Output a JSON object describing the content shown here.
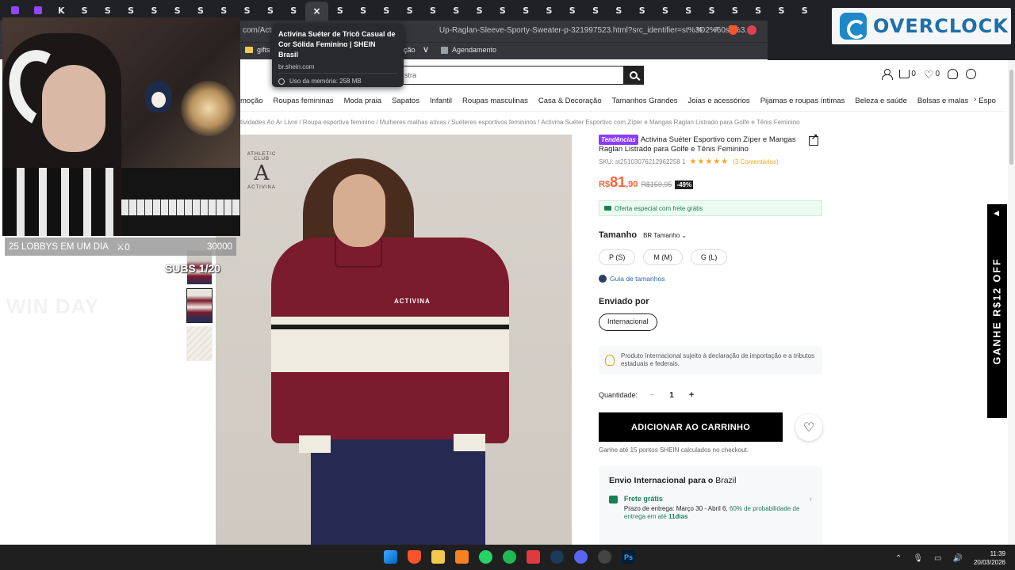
{
  "browser": {
    "tabs": [
      "twitch",
      "twitch",
      "kick",
      "S",
      "S",
      "S",
      "S",
      "S",
      "S",
      "S",
      "S",
      "S",
      "S",
      "×",
      "S",
      "S",
      "S",
      "S",
      "S",
      "S",
      "S",
      "S",
      "S",
      "S",
      "S",
      "S",
      "S",
      "S",
      "S",
      "S",
      "S",
      "S",
      "S",
      "S",
      "S"
    ],
    "active_tab_index": 13,
    "url_left": "com/Acti",
    "url_right": "Up-Raglan-Sleeve-Sporty-Sweater-p-321997523.html?src_identifier=st%3D2%60sc%3...",
    "bookmarks": [
      {
        "label": "gifts"
      },
      {
        "label": "ção"
      },
      {
        "label": "Agendamento"
      }
    ],
    "tooltip": {
      "title": "Activina Suéter de Tricô Casual de Cor Sólida Feminino | SHEIN Brasil",
      "domain": "br.shein.com",
      "memory": "Uso da memória: 258 MB"
    }
  },
  "logo": {
    "text": "OVERCLOCK"
  },
  "stream_overlay": {
    "stats_label": "25 LOBBYS EM UM DIA",
    "stats_count": "0",
    "stats_goal": "30000",
    "subs": "SUBS 1/20",
    "ghost_text": "WIN DAY"
  },
  "shein": {
    "search_placeholder": "stra",
    "header_counts": {
      "cart": "0",
      "wishlist": "0"
    },
    "categories": [
      "moção",
      "Roupas femininas",
      "Moda praia",
      "Sapatos",
      "Infantil",
      "Roupas masculinas",
      "Casa & Decoração",
      "Tamanhos Grandes",
      "Joias e acessórios",
      "Pijamas e roupas íntimas",
      "Beleza e saúde",
      "Bolsas e malas",
      "Espo"
    ],
    "breadcrumb": [
      "tividades Ao Ar Livre",
      "Roupa esportiva feminino",
      "Mulheres malhas ativas",
      "Suéteres esportivos femininos",
      "Activina Suéter Esportivo com Zíper e Mangas Raglan Listrado para Golfe e Tênis Feminino"
    ],
    "image_brand_mark": "ATHLETIC CLUB",
    "image_brand_sub": "ACTIVINA",
    "image_sweater_text": "ACTIVINA",
    "product": {
      "badge": "Tendências",
      "title": "Activina Suéter Esportivo com Zíper e Mangas Raglan Listrado para Golfe e Tênis Feminino",
      "sku": "SKU: st25103076212962258 1",
      "stars": "★★★★★",
      "reviews": "(3 Comentários)",
      "price_currency": "R$",
      "price_int": "81",
      "price_dec": ",90",
      "price_old": "R$159,95",
      "discount": "-49%",
      "offer": "Oferta especial com frete grátis",
      "size_label": "Tamanho",
      "size_system": "BR Tamanho ⌄",
      "sizes": [
        "P (S)",
        "M (M)",
        "G (L)"
      ],
      "size_guide": "Guia de tamanhos",
      "shipped_label": "Enviado por",
      "shipped_value": "Internacional",
      "intl_note": "Produto Internacional sujeito à declaração de importação e a tributos estaduais e federais.",
      "qty_label": "Quantidade:",
      "qty_minus": "−",
      "qty_value": "1",
      "qty_plus": "+",
      "add_to_cart": "ADICIONAR AO CARRINHO",
      "points": "Ganhe até 15 pontos SHEIN calculados no checkout.",
      "shipping": {
        "title_bold": "Envio Internacional para o",
        "title_country": "Brazil",
        "free_label": "Frete grátis",
        "delivery_text": "Prazo de entrega: Março 30 - Abril 6,",
        "probability": "60% de probabilidade de entrega em até",
        "days": "11dias"
      }
    },
    "side_banner": "GANHE R$12 OFF"
  },
  "taskbar": {
    "time": "11:39",
    "date": "20/03/2026",
    "ps_label": "Ps"
  }
}
